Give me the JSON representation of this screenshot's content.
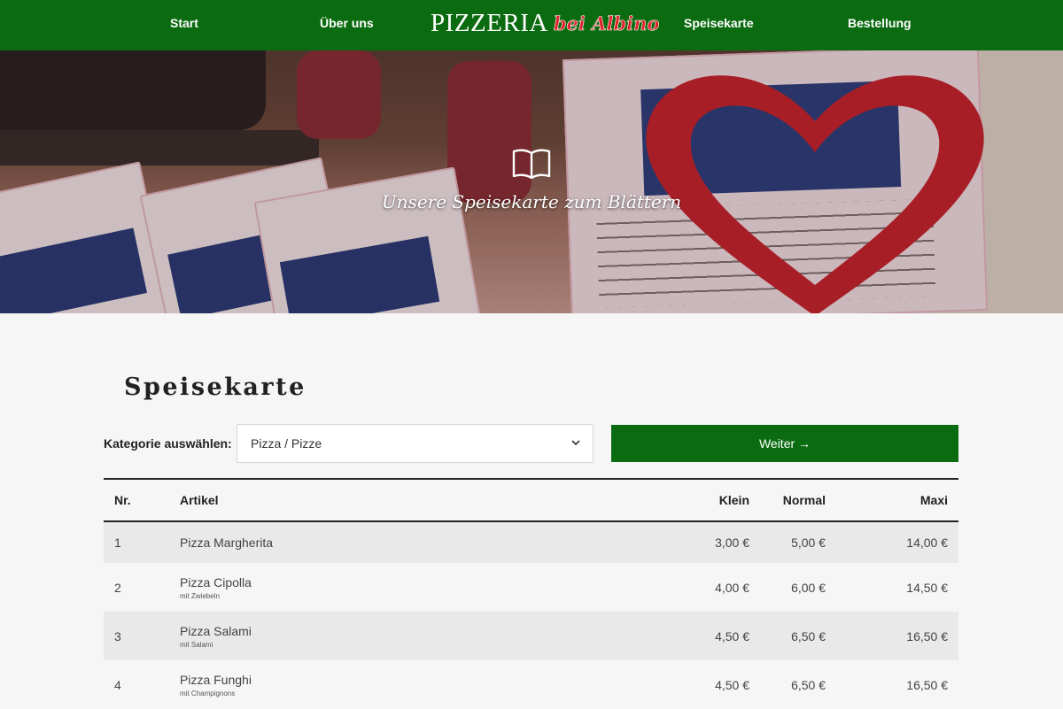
{
  "nav": {
    "items": [
      {
        "label": "Start"
      },
      {
        "label": "Über uns"
      },
      {
        "label": "Speisekarte"
      },
      {
        "label": "Bestellung"
      }
    ],
    "logo": {
      "main": "PIZZERIA",
      "script": "bei Albino"
    }
  },
  "hero": {
    "icon": "book-icon",
    "text": "Unsere Speisekarte zum Blättern"
  },
  "menu": {
    "title": "Speisekarte",
    "category_label": "Kategorie auswählen:",
    "category_value": "Pizza / Pizze",
    "next_button": "Weiter →",
    "columns": {
      "nr": "Nr.",
      "article": "Artikel",
      "small": "Klein",
      "normal": "Normal",
      "maxi": "Maxi"
    },
    "rows": [
      {
        "nr": "1",
        "name": "Pizza Margherita",
        "sub": "",
        "small": "3,00 €",
        "normal": "5,00 €",
        "maxi": "14,00 €"
      },
      {
        "nr": "2",
        "name": "Pizza Cipolla",
        "sub": "mit Zwiebeln",
        "small": "4,00 €",
        "normal": "6,00 €",
        "maxi": "14,50 €"
      },
      {
        "nr": "3",
        "name": "Pizza Salami",
        "sub": "mit Salami",
        "small": "4,50 €",
        "normal": "6,50 €",
        "maxi": "16,50 €"
      },
      {
        "nr": "4",
        "name": "Pizza Funghi",
        "sub": "mit Champignons",
        "small": "4,50 €",
        "normal": "6,50 €",
        "maxi": "16,50 €"
      }
    ]
  },
  "colors": {
    "brand_green": "#0b6b10",
    "logo_red": "#e0232a"
  }
}
